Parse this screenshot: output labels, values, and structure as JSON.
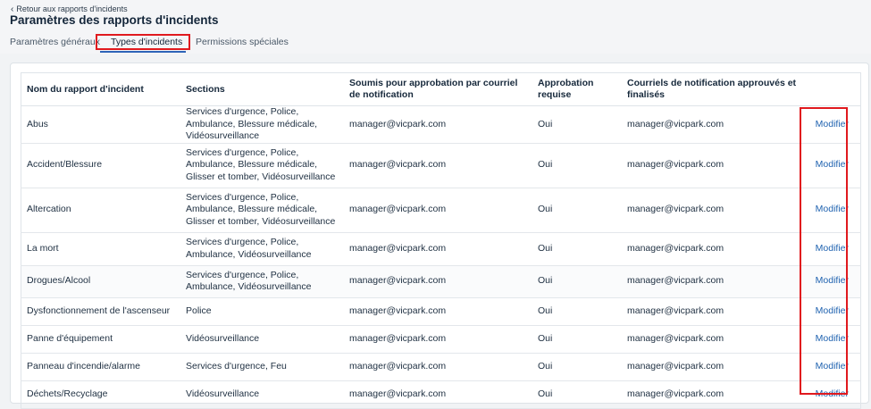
{
  "header": {
    "back_label": "Retour aux rapports d'incidents",
    "title": "Paramètres des rapports d'incidents"
  },
  "tabs": [
    {
      "label": "Paramètres généraux"
    },
    {
      "label": "Types d'incidents"
    },
    {
      "label": "Permissions spéciales"
    }
  ],
  "table": {
    "columns": [
      "Nom du rapport d'incident",
      "Sections",
      "Soumis pour approbation par courriel de notification",
      "Approbation requise",
      "Courriels de notification approuvés et finalisés",
      ""
    ],
    "rows": [
      {
        "name": "Abus",
        "sections": "Services d'urgence, Police, Ambulance, Blessure médicale, Vidéosurveillance",
        "submitted": "manager@vicpark.com",
        "approval": "Oui",
        "finalized": "manager@vicpark.com",
        "action": "Modifier"
      },
      {
        "name": "Accident/Blessure",
        "sections": "Services d'urgence, Police, Ambulance, Blessure médicale, Glisser et tomber, Vidéosurveillance",
        "submitted": "manager@vicpark.com",
        "approval": "Oui",
        "finalized": "manager@vicpark.com",
        "action": "Modifier"
      },
      {
        "name": "Altercation",
        "sections": "Services d'urgence, Police, Ambulance, Blessure médicale, Glisser et tomber, Vidéosurveillance",
        "submitted": "manager@vicpark.com",
        "approval": "Oui",
        "finalized": "manager@vicpark.com",
        "action": "Modifier"
      },
      {
        "name": "La mort",
        "sections": "Services d'urgence, Police, Ambulance, Vidéosurveillance",
        "submitted": "manager@vicpark.com",
        "approval": "Oui",
        "finalized": "manager@vicpark.com",
        "action": "Modifier"
      },
      {
        "name": "Drogues/Alcool",
        "sections": "Services d'urgence, Police, Ambulance, Vidéosurveillance",
        "submitted": "manager@vicpark.com",
        "approval": "Oui",
        "finalized": "manager@vicpark.com",
        "action": "Modifier"
      },
      {
        "name": "Dysfonctionnement de l'ascenseur",
        "sections": "Police",
        "submitted": "manager@vicpark.com",
        "approval": "Oui",
        "finalized": "manager@vicpark.com",
        "action": "Modifier"
      },
      {
        "name": "Panne d'équipement",
        "sections": "Vidéosurveillance",
        "submitted": "manager@vicpark.com",
        "approval": "Oui",
        "finalized": "manager@vicpark.com",
        "action": "Modifier"
      },
      {
        "name": "Panneau d'incendie/alarme",
        "sections": "Services d'urgence, Feu",
        "submitted": "manager@vicpark.com",
        "approval": "Oui",
        "finalized": "manager@vicpark.com",
        "action": "Modifier"
      },
      {
        "name": "Déchets/Recyclage",
        "sections": "Vidéosurveillance",
        "submitted": "manager@vicpark.com",
        "approval": "Oui",
        "finalized": "manager@vicpark.com",
        "action": "Modifier"
      }
    ]
  },
  "colors": {
    "accent": "#2063b0",
    "highlight": "#e0191e",
    "page_bg": "#f1f3f5"
  }
}
